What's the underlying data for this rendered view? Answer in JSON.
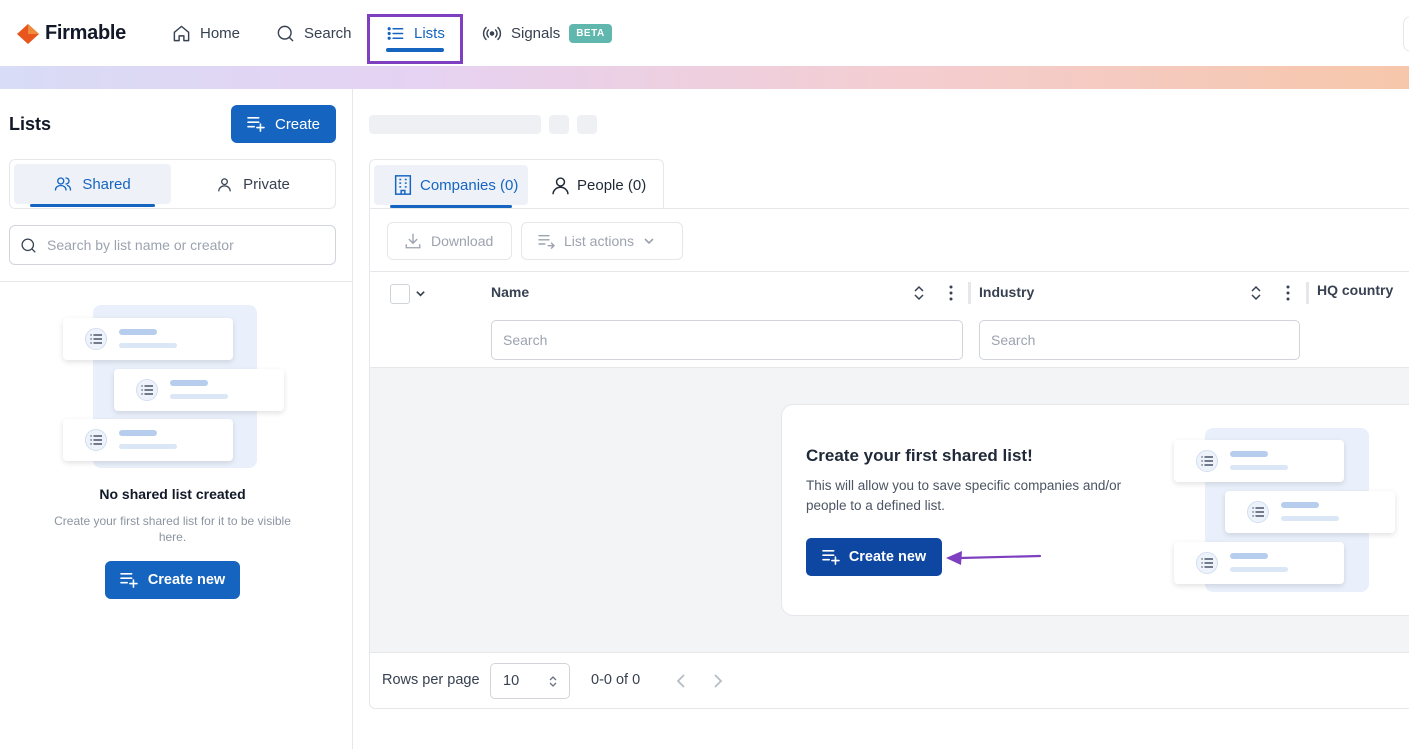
{
  "brand": {
    "name": "Firmable",
    "accent": "#1565c0",
    "logo_color": "#e8561d"
  },
  "nav": {
    "home": "Home",
    "search": "Search",
    "lists": "Lists",
    "signals": "Signals",
    "signals_badge": "BETA",
    "active": "Lists"
  },
  "sidebar": {
    "title": "Lists",
    "create_label": "Create",
    "tabs": {
      "shared": "Shared",
      "private": "Private",
      "active": "Shared"
    },
    "search_placeholder": "Search by list name or creator",
    "empty_title": "No shared list created",
    "empty_subtitle": "Create your first shared list for it to be visible here.",
    "create_new_label": "Create new"
  },
  "main": {
    "tabs": {
      "companies": "Companies (0)",
      "people": "People (0)",
      "active": "Companies (0)"
    },
    "toolbar": {
      "download": "Download",
      "list_actions": "List actions"
    },
    "columns": [
      {
        "label": "Name",
        "search_placeholder": "Search"
      },
      {
        "label": "Industry",
        "search_placeholder": "Search"
      },
      {
        "label": "HQ country"
      }
    ],
    "empty_state": {
      "title": "Create your first shared list!",
      "text": "This will allow you to save specific companies and/or people to a defined list.",
      "button": "Create new"
    },
    "pagination": {
      "rows_per_page_label": "Rows per page",
      "rows_per_page_value": "10",
      "range": "0-0 of 0"
    }
  },
  "annotations": {
    "highlight_color": "#7e3fc0"
  }
}
